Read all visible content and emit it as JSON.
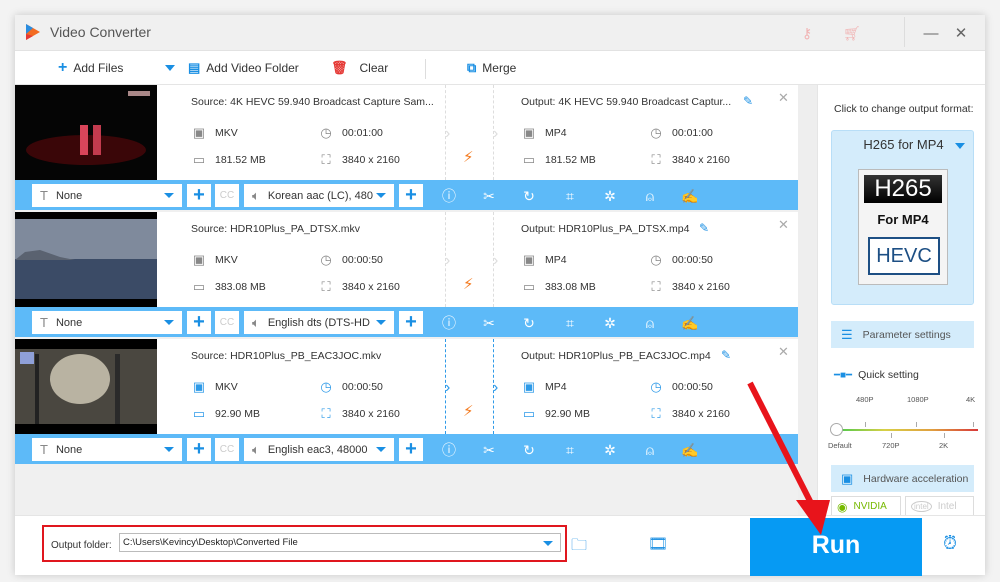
{
  "window": {
    "title": "Video Converter",
    "minimize_glyph": "—",
    "close_glyph": "✕"
  },
  "toolbar": {
    "add_files": "Add Files",
    "add_video_folder": "Add Video Folder",
    "clear": "Clear",
    "merge": "Merge"
  },
  "files": [
    {
      "source_title": "Source: 4K HEVC 59.940 Broadcast Capture Sam...",
      "source_format": "MKV",
      "source_duration": "00:01:00",
      "source_size": "181.52 MB",
      "source_resolution": "3840 x 2160",
      "output_title": "Output: 4K HEVC 59.940 Broadcast Captur...",
      "output_format": "MP4",
      "output_duration": "00:01:00",
      "output_size": "181.52 MB",
      "output_resolution": "3840 x 2160",
      "subtitle": "None",
      "audio": "Korean aac (LC), 480",
      "selected": false
    },
    {
      "source_title": "Source: HDR10Plus_PA_DTSX.mkv",
      "source_format": "MKV",
      "source_duration": "00:00:50",
      "source_size": "383.08 MB",
      "source_resolution": "3840 x 2160",
      "output_title": "Output: HDR10Plus_PA_DTSX.mp4",
      "output_format": "MP4",
      "output_duration": "00:00:50",
      "output_size": "383.08 MB",
      "output_resolution": "3840 x 2160",
      "subtitle": "None",
      "audio": "English dts (DTS-HD",
      "selected": false
    },
    {
      "source_title": "Source: HDR10Plus_PB_EAC3JOC.mkv",
      "source_format": "MKV",
      "source_duration": "00:00:50",
      "source_size": "92.90 MB",
      "source_resolution": "3840 x 2160",
      "output_title": "Output: HDR10Plus_PB_EAC3JOC.mp4",
      "output_format": "MP4",
      "output_duration": "00:00:50",
      "output_size": "92.90 MB",
      "output_resolution": "3840 x 2160",
      "subtitle": "None",
      "audio": "English eac3, 48000",
      "selected": true
    }
  ],
  "sidebar": {
    "caption": "Click to change output format:",
    "format_name": "H265 for MP4",
    "format_logo_top": "H265",
    "format_logo_mid": "For MP4",
    "format_logo_bottom": "HEVC",
    "parameter_settings": "Parameter settings",
    "quick_setting": "Quick setting",
    "quality_top_ticks": [
      "480P",
      "1080P",
      "4K"
    ],
    "quality_bottom_ticks": [
      "Default",
      "720P",
      "2K"
    ],
    "quality_selected": "Default",
    "hardware_acceleration": "Hardware acceleration",
    "nvidia": "NVIDIA",
    "intel": "Intel"
  },
  "footer": {
    "output_folder_label": "Output folder:",
    "output_folder_path": "C:\\Users\\Kevincy\\Desktop\\Converted File",
    "run": "Run"
  },
  "colors": {
    "accent": "#069af3",
    "row_bar": "#5dbaf8",
    "highlight_red": "#e0171e",
    "bolt": "#f47b20"
  }
}
